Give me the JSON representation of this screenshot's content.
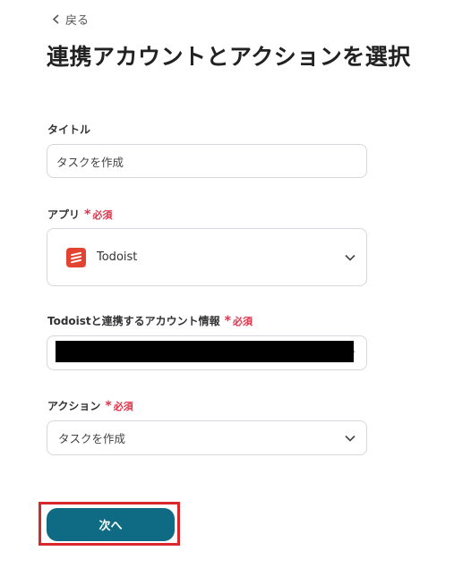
{
  "nav": {
    "back_label": "戻る"
  },
  "page": {
    "title": "連携アカウントとアクションを選択"
  },
  "required_text": "必須",
  "fields": {
    "title": {
      "label": "タイトル",
      "value": "タスクを作成"
    },
    "app": {
      "label": "アプリ",
      "value": "Todoist",
      "icon": "todoist-logo"
    },
    "account": {
      "label": "Todoistと連携するアカウント情報",
      "value": ""
    },
    "action": {
      "label": "アクション",
      "value": "タスクを作成"
    }
  },
  "buttons": {
    "next_label": "次へ"
  },
  "colors": {
    "primary": "#0f6a83",
    "required": "#e0334a",
    "todoist": "#e44332",
    "highlight": "#d9262a"
  }
}
